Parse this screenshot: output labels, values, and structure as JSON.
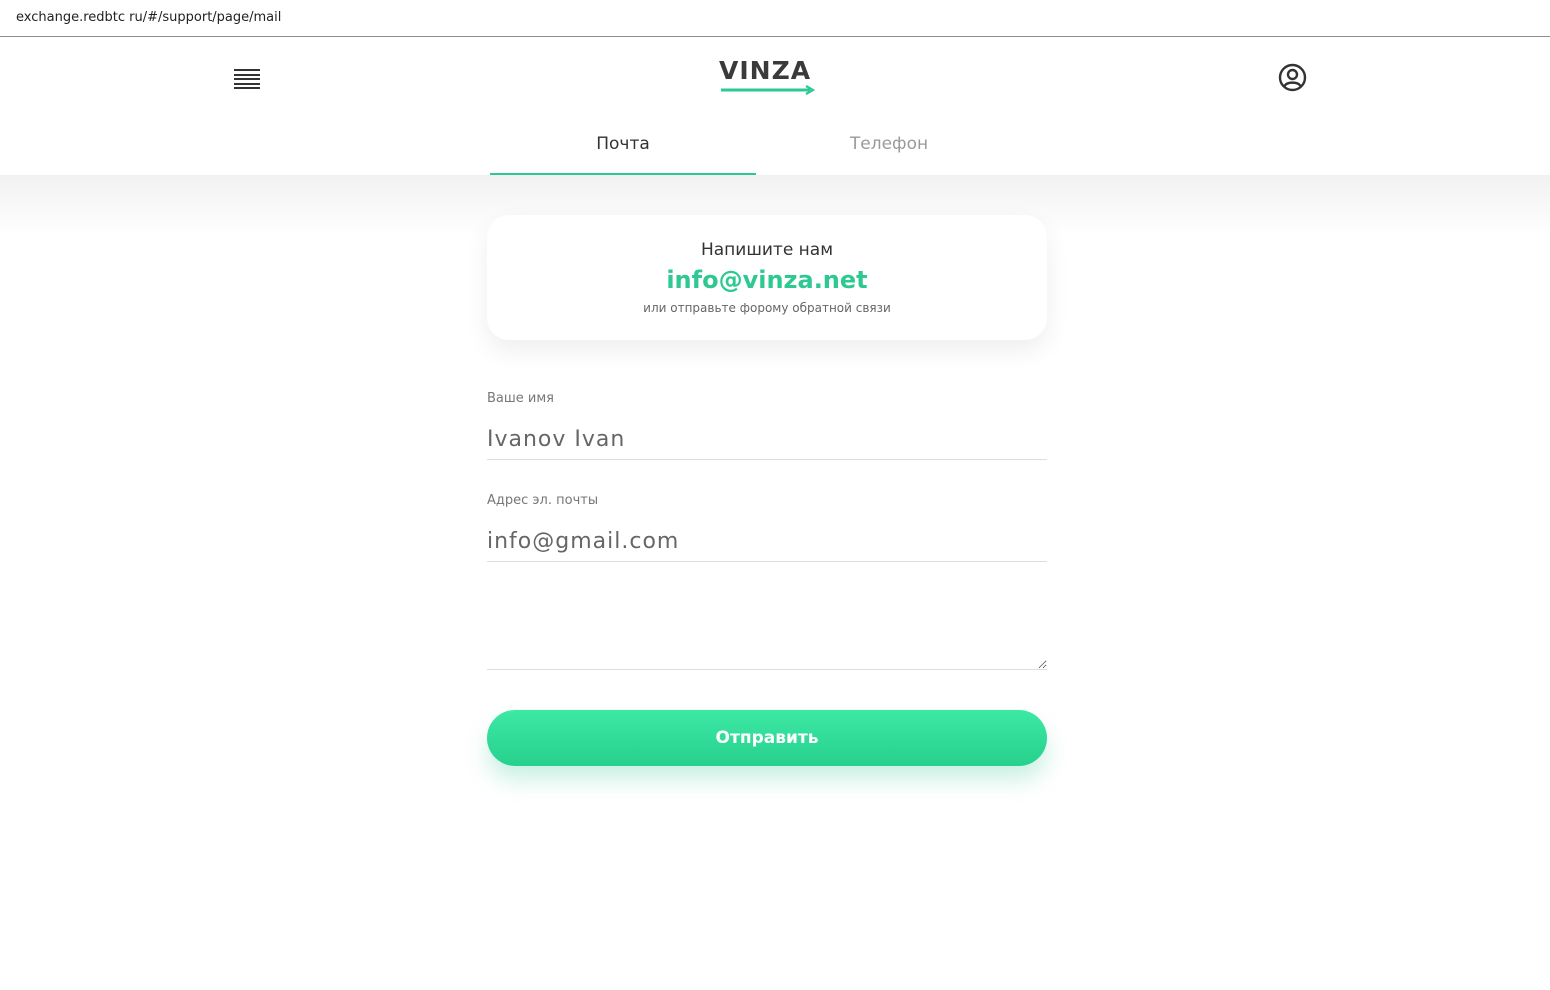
{
  "browser": {
    "url": "exchange.redbtc ru/#/support/page/mail"
  },
  "header": {
    "menu_icon": "hamburger-menu-icon",
    "logo_text": "VINZA",
    "user_icon": "user-circle-icon"
  },
  "tabs": [
    {
      "label": "Почта",
      "active": true
    },
    {
      "label": "Телефон",
      "active": false
    }
  ],
  "contact_card": {
    "title": "Напишите нам",
    "email": "info@vinza.net",
    "subtitle": "или отправьте форому обратной связи"
  },
  "form": {
    "name_label": "Ваше имя",
    "name_value": "Ivanov Ivan",
    "email_label": "Адрес эл. почты",
    "email_value": "info@gmail.com",
    "message_value": "",
    "submit_label": "Отправить"
  },
  "colors": {
    "accent": "#2ec993",
    "button_gradient_top": "#3ce9a4",
    "button_gradient_bottom": "#27d08d",
    "text_dark": "#333333",
    "text_muted": "#9a9a9a"
  }
}
